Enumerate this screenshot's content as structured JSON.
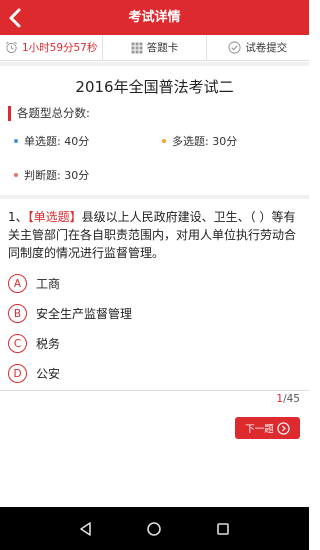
{
  "header": {
    "title": "考试详情",
    "back_icon": "chevron-left-icon"
  },
  "toolbar": {
    "timer": "1小时59分57秒",
    "answer_card": "答题卡",
    "submit": "试卷提交"
  },
  "exam": {
    "title": "2016年全国普法考试二",
    "summary_heading": "各题型总分数:",
    "types": [
      {
        "label": "单选题: 40分",
        "dot_color": "#4a90d9"
      },
      {
        "label": "多选题: 30分",
        "dot_color": "#f5a623"
      },
      {
        "label": "判断题: 30分",
        "dot_color": "#e8735a"
      }
    ]
  },
  "question": {
    "number": "1、",
    "type_tag": "【单选题】",
    "text": "县级以上人民政府建设、卫生、（ ）等有关主管部门在各自职责范围内，对用人单位执行劳动合同制度的情况进行监督管理。",
    "options": [
      {
        "letter": "A",
        "text": "工商"
      },
      {
        "letter": "B",
        "text": "安全生产监督管理"
      },
      {
        "letter": "C",
        "text": "税务"
      },
      {
        "letter": "D",
        "text": "公安"
      }
    ]
  },
  "pager": {
    "current": "1",
    "total": "/45"
  },
  "next_button": "下一题",
  "colors": {
    "accent": "#dd2a2f"
  }
}
